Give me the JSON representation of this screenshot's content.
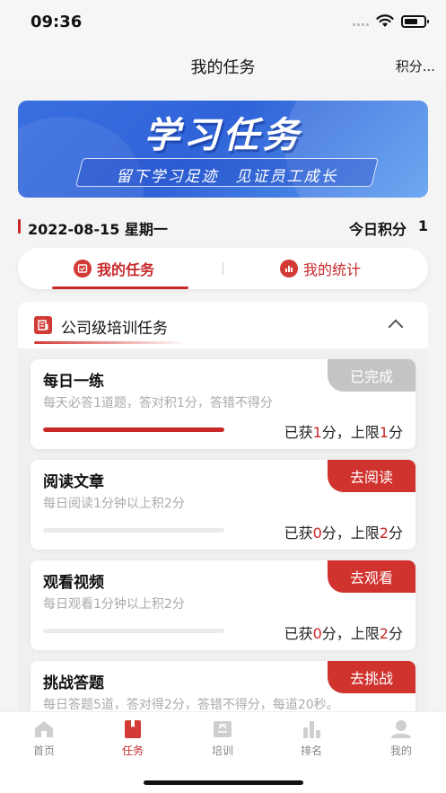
{
  "status": {
    "time": "09:36"
  },
  "nav": {
    "title": "我的任务",
    "right": "积分..."
  },
  "banner": {
    "title": "学习任务",
    "subtitle": "留下学习足迹　见证员工成长"
  },
  "summary": {
    "date": "2022-08-15 星期一",
    "score_label": "今日积分",
    "score_value": "1"
  },
  "tabs": [
    {
      "label": "我的任务",
      "icon": "task-icon",
      "active": true
    },
    {
      "label": "我的统计",
      "icon": "stats-icon",
      "active": false
    }
  ],
  "section": {
    "title": "公司级培训任务",
    "icon": "document-icon"
  },
  "tasks": [
    {
      "title": "每日一练",
      "desc": "每天必答1道题，答对积1分，答错不得分",
      "button": "已完成",
      "status": "done",
      "progress": 1.0,
      "got_label": "已获",
      "got": "1",
      "got_unit": "分，",
      "limit_label": "上限",
      "limit": "1",
      "limit_unit": "分"
    },
    {
      "title": "阅读文章",
      "desc": "每日阅读1分钟以上积2分",
      "button": "去阅读",
      "status": "todo",
      "progress": 0.0,
      "got_label": "已获",
      "got": "0",
      "got_unit": "分，",
      "limit_label": "上限",
      "limit": "2",
      "limit_unit": "分"
    },
    {
      "title": "观看视频",
      "desc": "每日观看1分钟以上积2分",
      "button": "去观看",
      "status": "todo",
      "progress": 0.0,
      "got_label": "已获",
      "got": "0",
      "got_unit": "分，",
      "limit_label": "上限",
      "limit": "2",
      "limit_unit": "分"
    },
    {
      "title": "挑战答题",
      "desc": "每日答题5道，答对得2分，答错不得分，每道20秒。",
      "button": "去挑战",
      "status": "todo"
    }
  ],
  "bottom_nav": [
    {
      "label": "首页",
      "icon": "home-icon",
      "active": false
    },
    {
      "label": "任务",
      "icon": "task-book-icon",
      "active": true
    },
    {
      "label": "培训",
      "icon": "training-icon",
      "active": false
    },
    {
      "label": "排名",
      "icon": "ranking-icon",
      "active": false
    },
    {
      "label": "我的",
      "icon": "profile-icon",
      "active": false
    }
  ],
  "colors": {
    "accent": "#c8282a",
    "banner": "#2f63d8",
    "done": "#c4c4c4"
  }
}
